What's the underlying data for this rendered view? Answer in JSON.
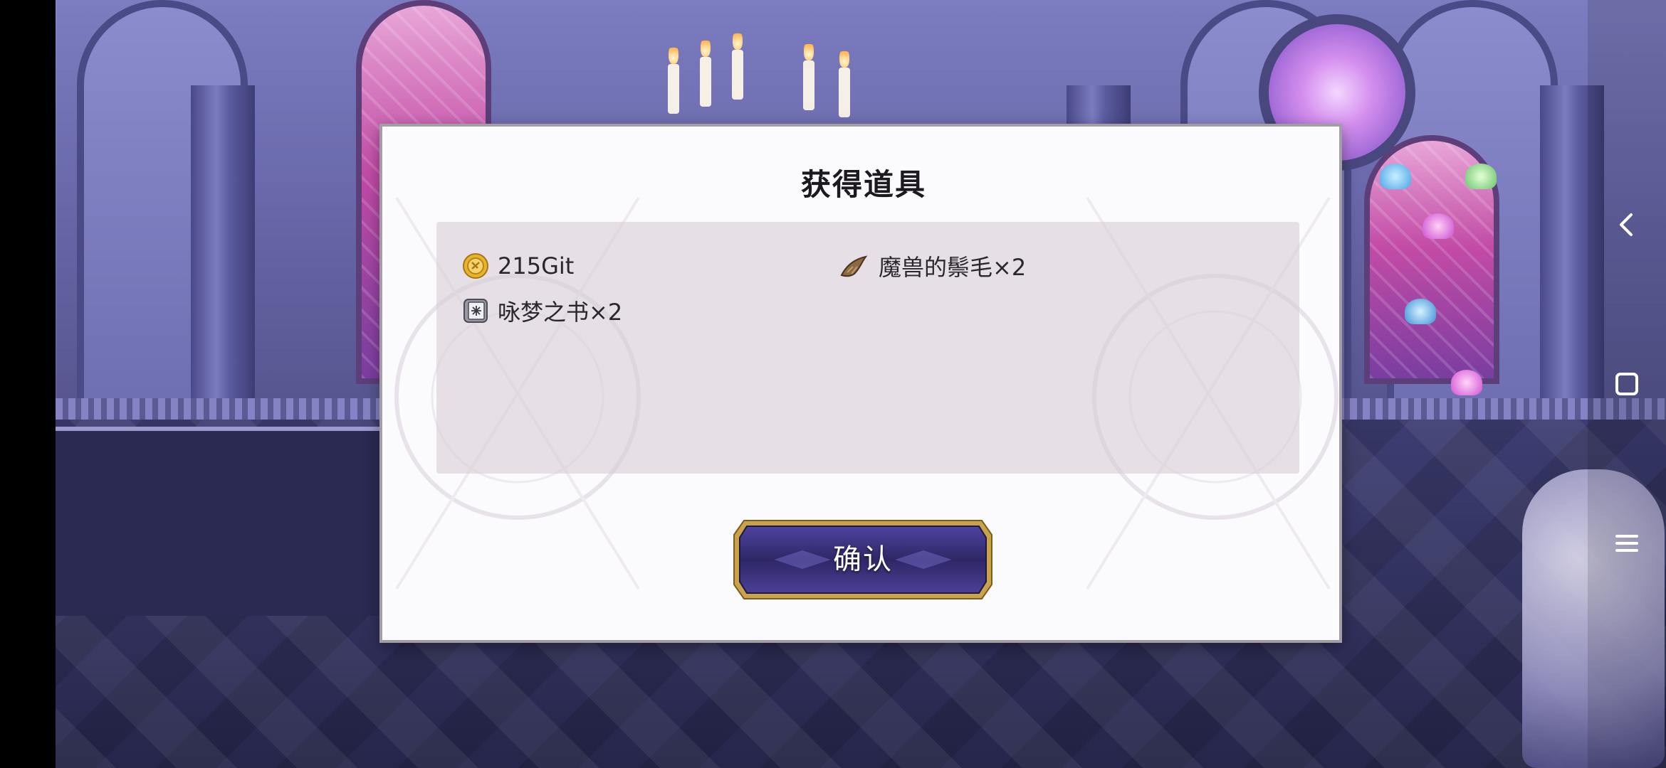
{
  "dialog": {
    "title": "获得道具",
    "rewards": [
      {
        "icon": "gold-coin-icon",
        "label": "215Git"
      },
      {
        "icon": "beast-horn-icon",
        "label": "魔兽的鬃毛×2"
      },
      {
        "icon": "spell-book-icon",
        "label": "咏梦之书×2"
      }
    ],
    "confirm_label": "确认"
  },
  "system_nav": {
    "back": "back-arrow-icon",
    "home": "square-home-icon",
    "menu": "hamburger-menu-icon"
  },
  "colors": {
    "dialog_bg": "#fbfafc",
    "panel_bg": "#dcd2d9",
    "button_gold": "#c9a24a",
    "button_purple": "#3b2f78"
  }
}
